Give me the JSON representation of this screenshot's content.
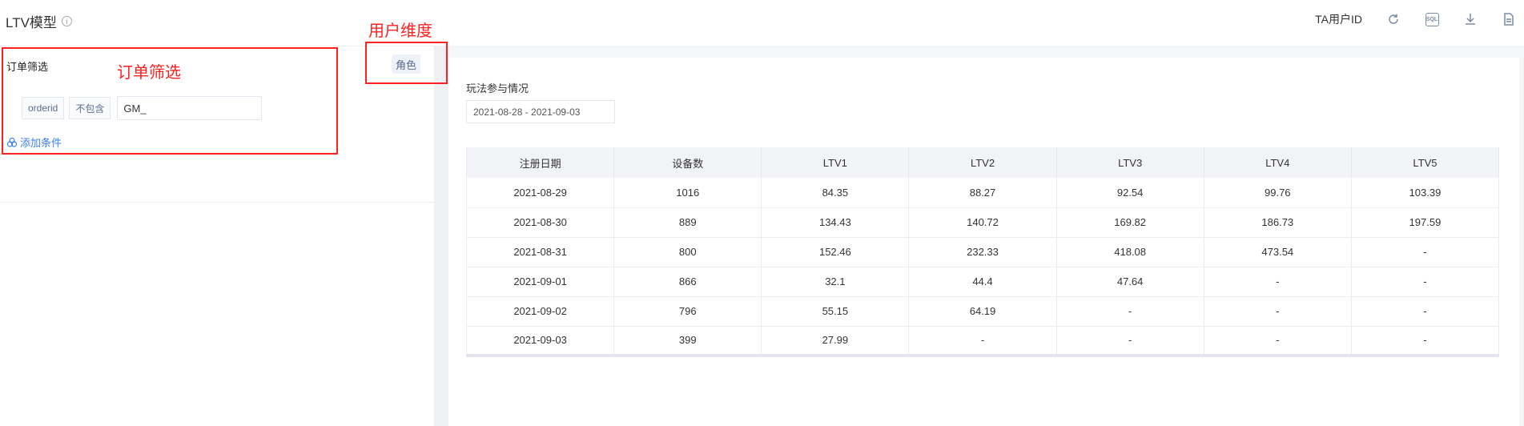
{
  "header": {
    "title": "LTV模型",
    "info_icon": "info-icon",
    "user_id_label": "TA用户ID",
    "icons": [
      "refresh-icon",
      "sql-icon",
      "download-icon",
      "document-icon"
    ],
    "sql_text": "SQL"
  },
  "left": {
    "section_label": "订单筛选",
    "role_button": "角色",
    "filter": {
      "field": "orderid",
      "operator": "不包含",
      "value": "GM_"
    },
    "add_condition": "添加条件"
  },
  "annotations": {
    "order_filter": "订单筛选",
    "user_dimension": "用户维度",
    "color": "#ff2020"
  },
  "right": {
    "title": "玩法参与情况",
    "date_range": "2021-08-28 - 2021-09-03",
    "table": {
      "headers": [
        "注册日期",
        "设备数",
        "LTV1",
        "LTV2",
        "LTV3",
        "LTV4",
        "LTV5"
      ],
      "rows": [
        [
          "2021-08-29",
          "1016",
          "84.35",
          "88.27",
          "92.54",
          "99.76",
          "103.39"
        ],
        [
          "2021-08-30",
          "889",
          "134.43",
          "140.72",
          "169.82",
          "186.73",
          "197.59"
        ],
        [
          "2021-08-31",
          "800",
          "152.46",
          "232.33",
          "418.08",
          "473.54",
          "-"
        ],
        [
          "2021-09-01",
          "866",
          "32.1",
          "44.4",
          "47.64",
          "-",
          "-"
        ],
        [
          "2021-09-02",
          "796",
          "55.15",
          "64.19",
          "-",
          "-",
          "-"
        ],
        [
          "2021-09-03",
          "399",
          "27.99",
          "-",
          "-",
          "-",
          "-"
        ]
      ]
    }
  },
  "colors": {
    "accent_link": "#3b82f6",
    "chip_text": "#5a6a90",
    "header_bg": "#f2f3f6"
  }
}
